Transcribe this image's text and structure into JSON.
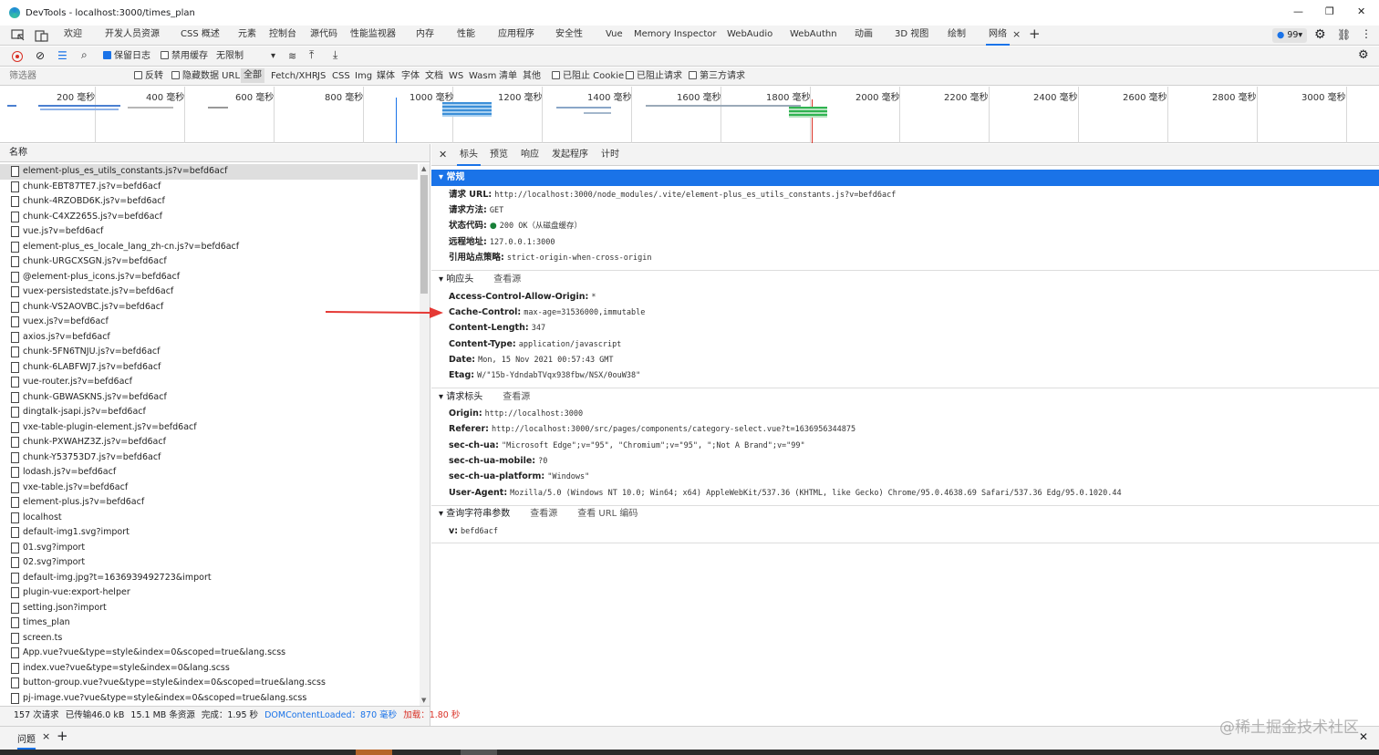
{
  "window": {
    "title": "DevTools - localhost:3000/times_plan"
  },
  "tabs": [
    "欢迎",
    "开发人员资源",
    "CSS 概述",
    "元素",
    "控制台",
    "源代码",
    "性能监视器",
    "内存",
    "性能",
    "应用程序",
    "安全性",
    "Vue",
    "Memory Inspector",
    "WebAudio",
    "WebAuthn",
    "动画",
    "3D 视图",
    "绘制",
    "网络"
  ],
  "issues_badge": "99",
  "toolbar": {
    "preserve_log": "保留日志",
    "disable_cache": "禁用缓存",
    "throttle": "无限制"
  },
  "filter": {
    "placeholder": "筛选器",
    "invert": "反转",
    "hide_data_url": "隐藏数据 URL",
    "types": [
      "全部",
      "Fetch/XHR",
      "JS",
      "CSS",
      "Img",
      "媒体",
      "字体",
      "文档",
      "WS",
      "Wasm",
      "清单",
      "其他"
    ],
    "blocked_cookies": "已阻止 Cookie",
    "blocked_requests": "已阻止请求",
    "third_party": "第三方请求"
  },
  "timeline": {
    "ticks": [
      "200 毫秒",
      "400 毫秒",
      "600 毫秒",
      "800 毫秒",
      "1000 毫秒",
      "1200 毫秒",
      "1400 毫秒",
      "1600 毫秒",
      "1800 毫秒",
      "2000 毫秒",
      "2200 毫秒",
      "2400 毫秒",
      "2600 毫秒",
      "2800 毫秒",
      "3000 毫秒"
    ]
  },
  "list": {
    "header": "名称",
    "items": [
      "element-plus_es_utils_constants.js?v=befd6acf",
      "chunk-EBT87TE7.js?v=befd6acf",
      "chunk-4RZOBD6K.js?v=befd6acf",
      "chunk-C4XZ265S.js?v=befd6acf",
      "vue.js?v=befd6acf",
      "element-plus_es_locale_lang_zh-cn.js?v=befd6acf",
      "chunk-URGCXSGN.js?v=befd6acf",
      "@element-plus_icons.js?v=befd6acf",
      "vuex-persistedstate.js?v=befd6acf",
      "chunk-VS2AOVBC.js?v=befd6acf",
      "vuex.js?v=befd6acf",
      "axios.js?v=befd6acf",
      "chunk-5FN6TNJU.js?v=befd6acf",
      "chunk-6LABFWJ7.js?v=befd6acf",
      "vue-router.js?v=befd6acf",
      "chunk-GBWASKNS.js?v=befd6acf",
      "dingtalk-jsapi.js?v=befd6acf",
      "vxe-table-plugin-element.js?v=befd6acf",
      "chunk-PXWAHZ3Z.js?v=befd6acf",
      "chunk-Y53753D7.js?v=befd6acf",
      "lodash.js?v=befd6acf",
      "vxe-table.js?v=befd6acf",
      "element-plus.js?v=befd6acf",
      "localhost",
      "default-img1.svg?import",
      "01.svg?import",
      "02.svg?import",
      "default-img.jpg?t=1636939492723&import",
      "plugin-vue:export-helper",
      "setting.json?import",
      "times_plan",
      "screen.ts",
      "App.vue?vue&type=style&index=0&scoped=true&lang.scss",
      "index.vue?vue&type=style&index=0&lang.scss",
      "button-group.vue?vue&type=style&index=0&scoped=true&lang.scss",
      "pj-image.vue?vue&type=style&index=0&scoped=true&lang.scss"
    ],
    "selected_index": 0
  },
  "status": {
    "requests": "157 次请求",
    "transferred": "已传输46.0 kB",
    "resources": "15.1 MB 条资源",
    "finish": "完成：1.95 秒",
    "dcl": "DOMContentLoaded：870 毫秒",
    "load": "加载：1.80 秒"
  },
  "detail": {
    "tabs": [
      "标头",
      "预览",
      "响应",
      "发起程序",
      "计时"
    ],
    "general": {
      "title": "常规",
      "rows": [
        {
          "k": "请求 URL:",
          "v": "http://localhost:3000/node_modules/.vite/element-plus_es_utils_constants.js?v=befd6acf"
        },
        {
          "k": "请求方法:",
          "v": "GET"
        },
        {
          "k": "状态代码:",
          "v": "200 OK（从磁盘缓存）"
        },
        {
          "k": "远程地址:",
          "v": "127.0.0.1:3000"
        },
        {
          "k": "引用站点策略:",
          "v": "strict-origin-when-cross-origin"
        }
      ]
    },
    "response": {
      "title": "响应头",
      "view_source": "查看源",
      "rows": [
        {
          "k": "Access-Control-Allow-Origin:",
          "v": "*"
        },
        {
          "k": "Cache-Control:",
          "v": "max-age=31536000,immutable"
        },
        {
          "k": "Content-Length:",
          "v": "347"
        },
        {
          "k": "Content-Type:",
          "v": "application/javascript"
        },
        {
          "k": "Date:",
          "v": "Mon, 15 Nov 2021 00:57:43 GMT"
        },
        {
          "k": "Etag:",
          "v": "W/\"15b-YdndabTVqx938fbw/NSX/0ouW38\""
        }
      ]
    },
    "request": {
      "title": "请求标头",
      "view_source": "查看源",
      "rows": [
        {
          "k": "Origin:",
          "v": "http://localhost:3000"
        },
        {
          "k": "Referer:",
          "v": "http://localhost:3000/src/pages/components/category-select.vue?t=1636956344875"
        },
        {
          "k": "sec-ch-ua:",
          "v": "\"Microsoft Edge\";v=\"95\", \"Chromium\";v=\"95\", \";Not A Brand\";v=\"99\""
        },
        {
          "k": "sec-ch-ua-mobile:",
          "v": "?0"
        },
        {
          "k": "sec-ch-ua-platform:",
          "v": "\"Windows\""
        },
        {
          "k": "User-Agent:",
          "v": "Mozilla/5.0 (Windows NT 10.0; Win64; x64) AppleWebKit/537.36 (KHTML, like Gecko) Chrome/95.0.4638.69 Safari/537.36 Edg/95.0.1020.44"
        }
      ]
    },
    "query": {
      "title": "查询字符串参数",
      "view_source": "查看源",
      "view_url_encoded": "查看 URL 编码",
      "rows": [
        {
          "k": "v:",
          "v": "befd6acf"
        }
      ]
    }
  },
  "drawer": {
    "tab": "问题"
  },
  "watermark": "@稀土掘金技术社区",
  "colors": {
    "accent": "#1a73e8",
    "arrow": "#e53935",
    "record": "#d93025"
  }
}
